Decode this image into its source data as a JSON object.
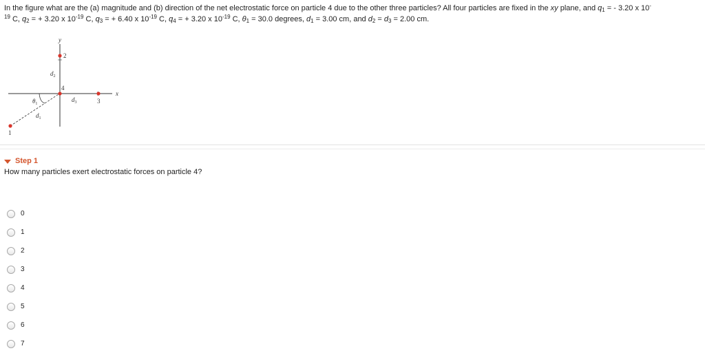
{
  "problem": {
    "line1": {
      "intro": "In the figure what are the (a) magnitude and (b) direction of the net electrostatic force on particle 4 due to the other three particles? All four particles are fixed in the ",
      "xy": "xy",
      "plane": " plane, and ",
      "q": "q",
      "q1_sub": "1",
      "q1_value": " = - 3.20 x 10",
      "exp_cut": "-"
    },
    "line2": {
      "exp_rest": "19",
      "c1": " C, ",
      "q2_sub": "2",
      "q2_value": " = + 3.20 x 10",
      "q2_exp": "-19",
      "c2": " C, ",
      "q3_sub": "3",
      "q3_value": " = + 6.40 x 10",
      "q3_exp": "-19",
      "c3": " C, ",
      "q4_sub": "4",
      "q4_value": " = + 3.20 x 10",
      "q4_exp": "-19",
      "c4": " C, ",
      "theta": "θ",
      "theta_sub": "1",
      "theta_value": " = 30.0 degrees, ",
      "d": "d",
      "d1_sub": "1",
      "d1_value": " = 3.00 cm, and ",
      "d2_sub": "2",
      "eq": " = ",
      "d3_sub": "3",
      "d_value": " = 2.00 cm."
    }
  },
  "figure": {
    "axis_x": "x",
    "axis_y": "y",
    "particle_1": "1",
    "particle_2": "2",
    "particle_3": "3",
    "particle_4": "4",
    "d1_label": "d",
    "d1_sub": "1",
    "d2_label": "d",
    "d2_sub": "2",
    "d3_label": "d",
    "d3_sub": "3",
    "theta_label": "θ",
    "theta_sub": "1",
    "particle_color": "#d9352b"
  },
  "step": {
    "title": "Step 1",
    "question": "How many particles exert electrostatic forces on particle 4?",
    "accent_color": "#d4562e"
  },
  "options": [
    "0",
    "1",
    "2",
    "3",
    "4",
    "5",
    "6",
    "7"
  ]
}
